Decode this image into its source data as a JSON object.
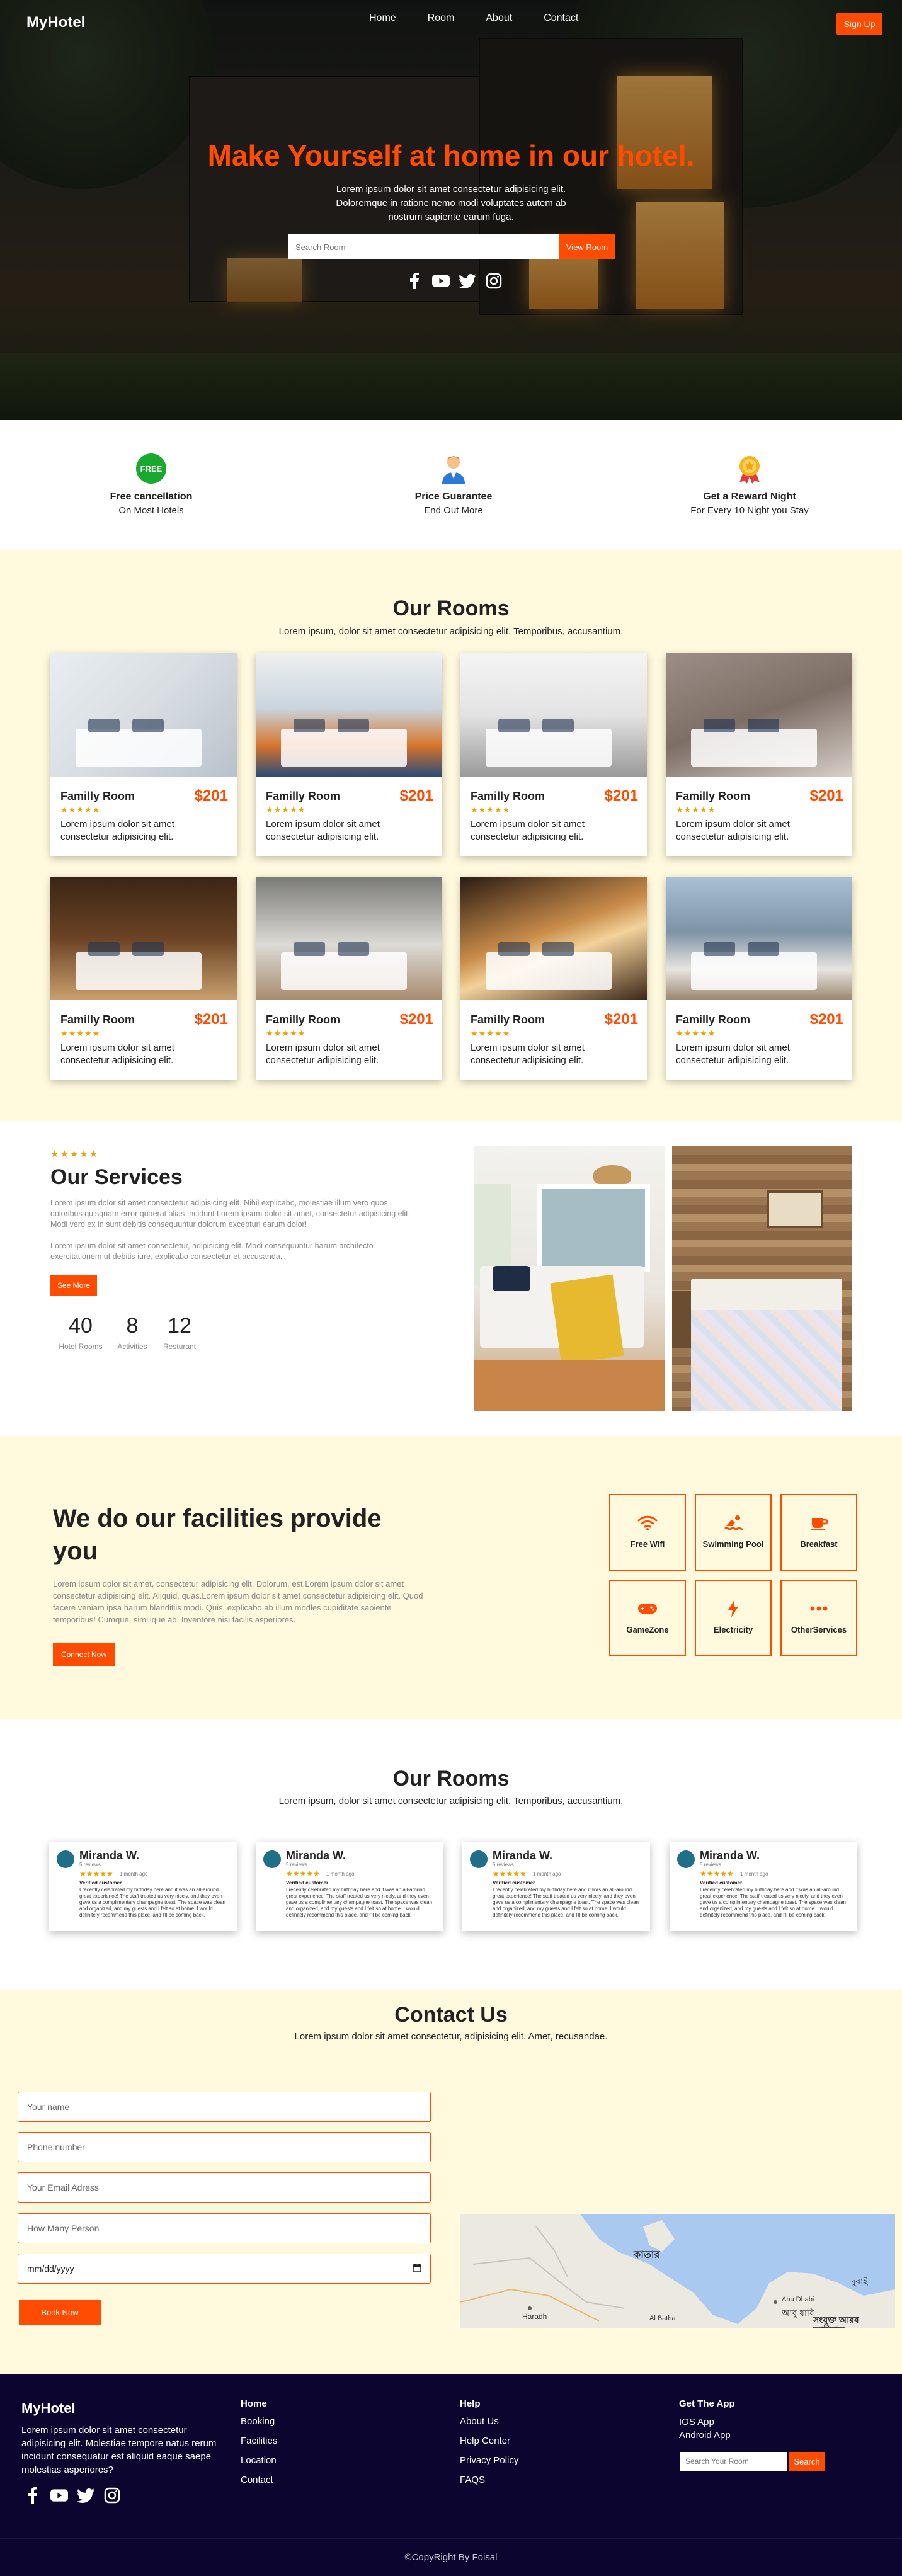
{
  "nav": {
    "logo": "MyHotel",
    "links": [
      "Home",
      "Room",
      "About",
      "Contact"
    ],
    "signup": "Sign Up"
  },
  "hero": {
    "title": "Make Yourself at home in our hotel.",
    "subtitle": "Lorem ipsum dolor sit amet consectetur adipisicing elit. Doloremque in ratione nemo modi voluptates autem ab nostrum sapiente earum fuga.",
    "search_placeholder": "Search Room",
    "view_button": "View Room"
  },
  "features": [
    {
      "icon": "free-badge-icon",
      "badge": "FREE",
      "title": "Free cancellation",
      "subtitle": "On Most Hotels"
    },
    {
      "icon": "person-icon",
      "title": "Price Guarantee",
      "subtitle": "End Out More"
    },
    {
      "icon": "medal-icon",
      "title": "Get a Reward Night",
      "subtitle": "For Every 10 Night you Stay"
    }
  ],
  "rooms": {
    "title": "Our Rooms",
    "subtitle": "Lorem ipsum, dolor sit amet consectetur adipisicing elit. Temporibus, accusantium.",
    "cards": [
      {
        "name": "Familly Room",
        "price": "$201",
        "stars": "★★★★★",
        "desc": "Lorem ipsum dolor sit amet consectetur adipisicing elit."
      },
      {
        "name": "Familly Room",
        "price": "$201",
        "stars": "★★★★★",
        "desc": "Lorem ipsum dolor sit amet consectetur adipisicing elit."
      },
      {
        "name": "Familly Room",
        "price": "$201",
        "stars": "★★★★★",
        "desc": "Lorem ipsum dolor sit amet consectetur adipisicing elit."
      },
      {
        "name": "Familly Room",
        "price": "$201",
        "stars": "★★★★★",
        "desc": "Lorem ipsum dolor sit amet consectetur adipisicing elit."
      },
      {
        "name": "Familly Room",
        "price": "$201",
        "stars": "★★★★★",
        "desc": "Lorem ipsum dolor sit amet consectetur adipisicing elit."
      },
      {
        "name": "Familly Room",
        "price": "$201",
        "stars": "★★★★★",
        "desc": "Lorem ipsum dolor sit amet consectetur adipisicing elit."
      },
      {
        "name": "Familly Room",
        "price": "$201",
        "stars": "★★★★★",
        "desc": "Lorem ipsum dolor sit amet consectetur adipisicing elit."
      },
      {
        "name": "Familly Room",
        "price": "$201",
        "stars": "★★★★★",
        "desc": "Lorem ipsum dolor sit amet consectetur adipisicing elit."
      }
    ]
  },
  "services": {
    "stars": "★★★★★",
    "title": "Our Services",
    "p1": "Lorem ipsum dolor sit amet consectetur adipisicing elit. Nihil explicabo, molestiae illum vero quos doloribus quisquam error quaerat alias Incidunt Lorem ipsum dolor sit amet, consectetur adipisicing elit. Modi vero ex in sunt debitis consequuntur dolorum excepturi earum dolor!",
    "p2": "Lorem ipsum dolor sit amet consectetur, adipisicing elit. Modi consequuntur harum architecto exercitationem ut debitis iure, explicabo consectetur et accusanda.",
    "see_more": "See More",
    "stats": [
      {
        "value": "40",
        "label": "Hotel Rooms"
      },
      {
        "value": "8",
        "label": "Activities"
      },
      {
        "value": "12",
        "label": "Resturant"
      }
    ]
  },
  "facilities": {
    "title": "We do our facilities provide you",
    "desc": "Lorem ipsum dolor sit amet, consectetur adipisicing elit. Dolorum, est.Lorem ipsum dolor sit amet consectetur adipisicing elit. Aliquid, quas.Lorem ipsum dolor sit amet consectetur adipisicing elit. Quod facere veniam ipsa harum blanditiis modi. Quis, explicabo ab illum modles cupiditate sapiente temporibus! Cumque, similique ab. Inventore nisi facilis asperiores.",
    "connect": "Connect Now",
    "items": [
      {
        "icon": "wifi-icon",
        "label": "Free Wifi"
      },
      {
        "icon": "swimmer-icon",
        "label": "Swimming Pool"
      },
      {
        "icon": "coffee-icon",
        "label": "Breakfast"
      },
      {
        "icon": "gamepad-icon",
        "label": "GameZone"
      },
      {
        "icon": "bolt-icon",
        "label": "Electricity"
      },
      {
        "icon": "dots-icon",
        "label": "OtherServices"
      }
    ]
  },
  "reviews": {
    "title": "Our Rooms",
    "subtitle": "Lorem ipsum, dolor sit amet consectetur adipisicing elit. Temporibus, accusantium.",
    "cards": [
      {
        "name": "Miranda W.",
        "sub": "5 reviews",
        "stars": "★★★★★",
        "meta": "1 month ago",
        "label": "Verified customer",
        "body": "I recently celebrated my birthday here and it was an all-around great experience! The staff treated us very nicely, and they even gave us a complimentary champagne toast. The space was clean and organized, and my guests and I felt so at home. I would definitely recommend this place, and I'll be coming back."
      },
      {
        "name": "Miranda W.",
        "sub": "5 reviews",
        "stars": "★★★★★",
        "meta": "1 month ago",
        "label": "Verified customer",
        "body": "I recently celebrated my birthday here and it was an all-around great experience! The staff treated us very nicely, and they even gave us a complimentary champagne toast. The space was clean and organized, and my guests and I felt so at home. I would definitely recommend this place, and I'll be coming back."
      },
      {
        "name": "Miranda W.",
        "sub": "5 reviews",
        "stars": "★★★★★",
        "meta": "1 month ago",
        "label": "Verified customer",
        "body": "I recently celebrated my birthday here and it was an all-around great experience! The staff treated us very nicely, and they even gave us a complimentary champagne toast. The space was clean and organized, and my guests and I felt so at home. I would definitely recommend this place, and I'll be coming back."
      },
      {
        "name": "Miranda W.",
        "sub": "5 reviews",
        "stars": "★★★★★",
        "meta": "1 month ago",
        "label": "Verified customer",
        "body": "I recently celebrated my birthday here and it was an all-around great experience! The staff treated us very nicely, and they even gave us a complimentary champagne toast. The space was clean and organized, and my guests and I felt so at home. I would definitely recommend this place, and I'll be coming back."
      }
    ]
  },
  "contact": {
    "title": "Contact Us",
    "subtitle": "Lorem ipsum dolor sit amet consectetur, adipisicing elit. Amet, recusandae.",
    "fields": [
      "Your name",
      "Phone number",
      "Your Email Adress",
      "How Many Person",
      "mm/dd/yyyy"
    ],
    "book": "Book Now",
    "map_labels": {
      "city1": "কাতার",
      "city2": "Haradh",
      "city3": "Al Batha",
      "city4": "Abu Dhabi",
      "city5": "আবু ধাবি",
      "city6": "দুবাই",
      "city7": "সংযুক্ত আরব আমিরাত"
    }
  },
  "footer": {
    "logo": "MyHotel",
    "about": "Lorem ipsum dolor sit amet consectetur adipisicing elit. Molestiae tempore natus rerum incidunt consequatur est aliquid eaque saepe molestias asperiores?",
    "col1": {
      "title": "Home",
      "links": [
        "Booking",
        "Facilities",
        "Location",
        "Contact"
      ]
    },
    "col2": {
      "title": "Help",
      "links": [
        "About Us",
        "Help Center",
        "Privacy Policy",
        "FAQS"
      ]
    },
    "col3": {
      "title": "Get The App",
      "links": [
        "IOS App",
        "Android App"
      ],
      "search_placeholder": "Search Your Room",
      "search_button": "Search"
    },
    "copyright": "©CopyRight By Foisal"
  },
  "colors": {
    "accent": "#ff4c00",
    "cream": "#fff9de",
    "footer": "#0b0530",
    "star": "#e8a400"
  }
}
